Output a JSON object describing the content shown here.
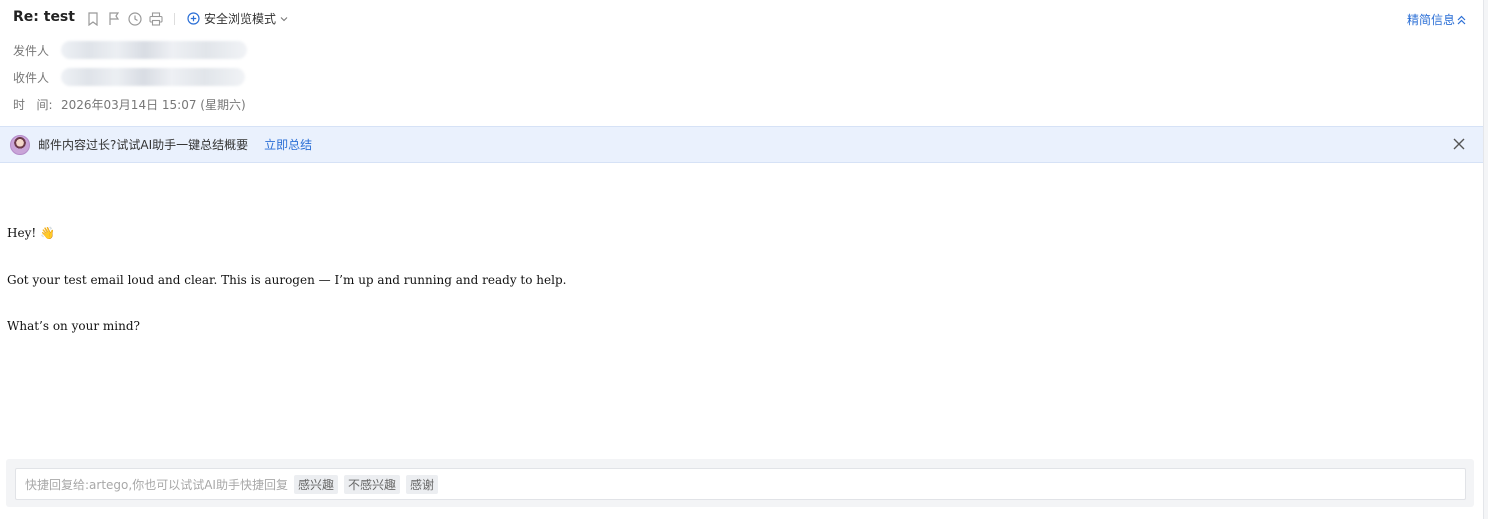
{
  "header": {
    "subject": "Re: test",
    "safe_mode_label": "安全浏览模式",
    "brief_label": "精简信息"
  },
  "meta": {
    "from_label": "发件人",
    "to_label": "收件人",
    "time_label": "时   间:",
    "time_value": "2026年03月14日 15:07 (星期六)"
  },
  "ai_banner": {
    "text": "邮件内容过长?试试AI助手一键总结概要",
    "action": "立即总结"
  },
  "body": {
    "line1": "Hey! 👋",
    "line2": "Got your test email loud and clear. This is aurogen — I’m up and running and ready to help.",
    "line3": "What’s on your mind?"
  },
  "quick_reply": {
    "placeholder": "快捷回复给:artego,你也可以试试AI助手快捷回复",
    "chips": [
      "感兴趣",
      "不感兴趣",
      "感谢"
    ]
  },
  "colors": {
    "accent": "#2b6fd6",
    "banner_bg": "#eaf1fd"
  }
}
